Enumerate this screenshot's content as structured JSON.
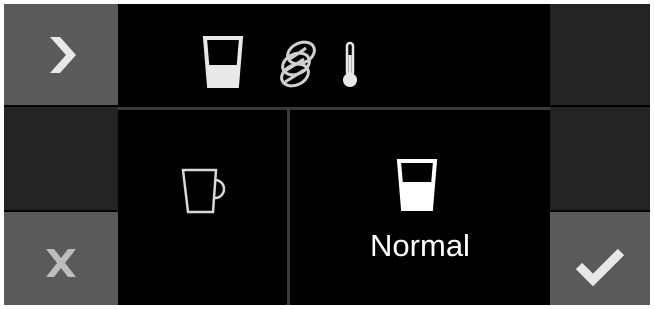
{
  "colors": {
    "background": "#000000",
    "button_light": "#5a5a5a",
    "button_dark": "#242424",
    "icon_light": "#e8e8e8",
    "icon_dim": "#bdbdbd",
    "text": "#ffffff"
  },
  "left_buttons": [
    {
      "name": "next-button",
      "icon": "chevron-right-icon"
    },
    {
      "name": "empty-left-button",
      "icon": ""
    },
    {
      "name": "cancel-button",
      "icon": "close-icon"
    }
  ],
  "right_buttons": [
    {
      "name": "empty-right-button-top",
      "icon": ""
    },
    {
      "name": "empty-right-button-middle",
      "icon": ""
    },
    {
      "name": "confirm-button",
      "icon": "checkmark-icon"
    }
  ],
  "header_icons": [
    "glass-half-full-icon",
    "coffee-beans-icon",
    "thermometer-icon"
  ],
  "options": [
    {
      "name": "option-cup",
      "icon": "cup-icon",
      "label": ""
    },
    {
      "name": "option-normal",
      "icon": "glass-half-full-icon",
      "label": "Normal"
    }
  ]
}
